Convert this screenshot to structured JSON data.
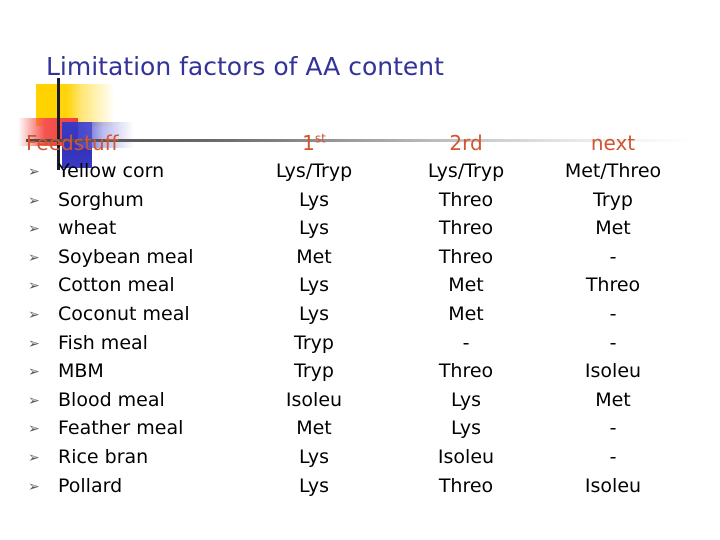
{
  "slide": {
    "title": "Limitation factors of AA content",
    "title_color": "#333399",
    "background": "#ffffff"
  },
  "decoration": {
    "name": "powerpoint-squares-motif",
    "yellow": "#FFD200",
    "red": "#F0413C",
    "blue": "#3333BB",
    "line": "#1b1b2b"
  },
  "table": {
    "header_color": "#D2552F",
    "headers": {
      "feedstuff": "Feedstuff",
      "first_main": "1",
      "first_sup": "st",
      "second": "2rd",
      "next": "next"
    },
    "bullet_glyph": "➢",
    "rows": [
      {
        "name": "Yellow  corn",
        "first": "Lys/Tryp",
        "second": "Lys/Tryp",
        "next": "Met/Threo"
      },
      {
        "name": "Sorghum",
        "first": "Lys",
        "second": "Threo",
        "next": "Tryp"
      },
      {
        "name": "wheat",
        "first": "Lys",
        "second": "Threo",
        "next": "Met"
      },
      {
        "name": "Soybean meal",
        "first": "Met",
        "second": "Threo",
        "next": "-"
      },
      {
        "name": "Cotton meal",
        "first": "Lys",
        "second": "Met",
        "next": "Threo"
      },
      {
        "name": "Coconut meal",
        "first": "Lys",
        "second": "Met",
        "next": "-"
      },
      {
        "name": "Fish meal",
        "first": "Tryp",
        "second": "-",
        "next": "-"
      },
      {
        "name": "MBM",
        "first": "Tryp",
        "second": "Threo",
        "next": "Isoleu"
      },
      {
        "name": "Blood meal",
        "first": "Isoleu",
        "second": "Lys",
        "next": "Met"
      },
      {
        "name": "Feather meal",
        "first": "Met",
        "second": "Lys",
        "next": "-"
      },
      {
        "name": "Rice bran",
        "first": "Lys",
        "second": "Isoleu",
        "next": "-"
      },
      {
        "name": "Pollard",
        "first": "Lys",
        "second": "Threo",
        "next": "Isoleu"
      }
    ]
  }
}
